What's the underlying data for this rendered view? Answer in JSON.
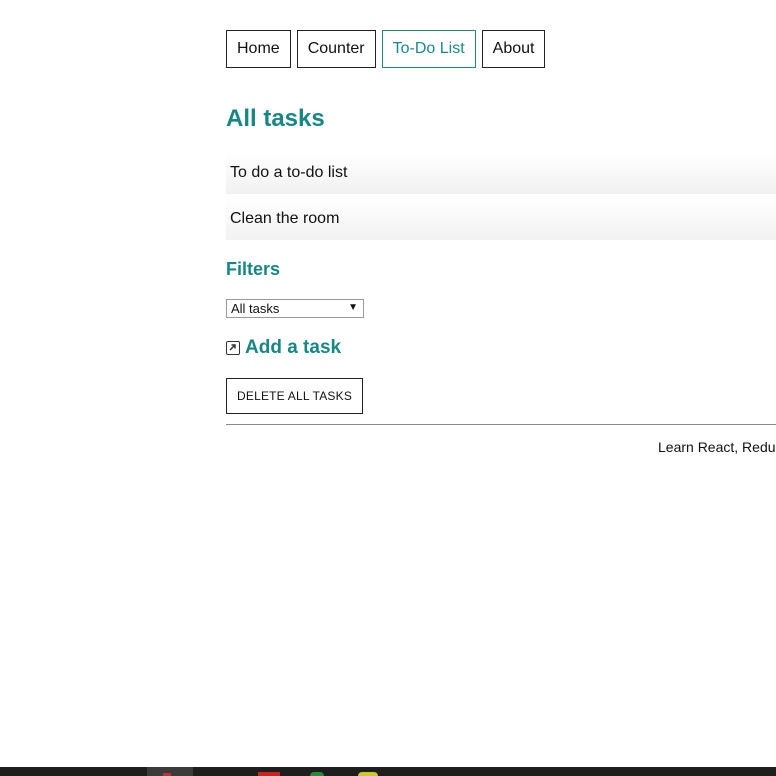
{
  "nav": {
    "items": [
      {
        "label": "Home",
        "active": false
      },
      {
        "label": "Counter",
        "active": false
      },
      {
        "label": "To-Do List",
        "active": true
      },
      {
        "label": "About",
        "active": false
      }
    ]
  },
  "main": {
    "title": "All tasks",
    "tasks": [
      {
        "label": "To do a to-do list"
      },
      {
        "label": "Clean the room"
      }
    ],
    "filters_title": "Filters",
    "filter_selected": "All tasks",
    "add_task_label": "Add a task",
    "delete_all_label": "DELETE ALL TASKS"
  },
  "footer": {
    "text": "Learn React, Redu"
  },
  "colors": {
    "accent": "#178784",
    "taskbar": "#1e1e1e"
  }
}
